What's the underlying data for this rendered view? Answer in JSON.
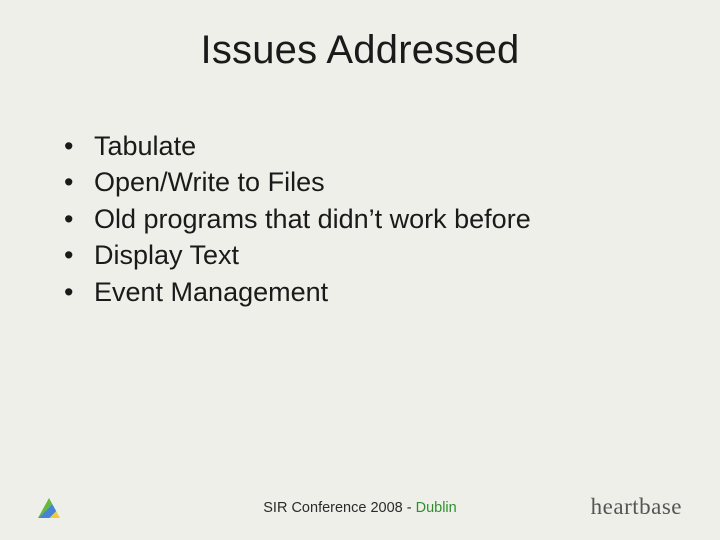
{
  "title": "Issues Addressed",
  "bullets": [
    "Tabulate",
    "Open/Write to Files",
    "Old programs that didn’t work before",
    "Display Text",
    "Event Management"
  ],
  "footer": {
    "center_prefix": "SIR Conference 2008 - ",
    "center_location": "Dublin",
    "right_brand": "heartbase"
  }
}
